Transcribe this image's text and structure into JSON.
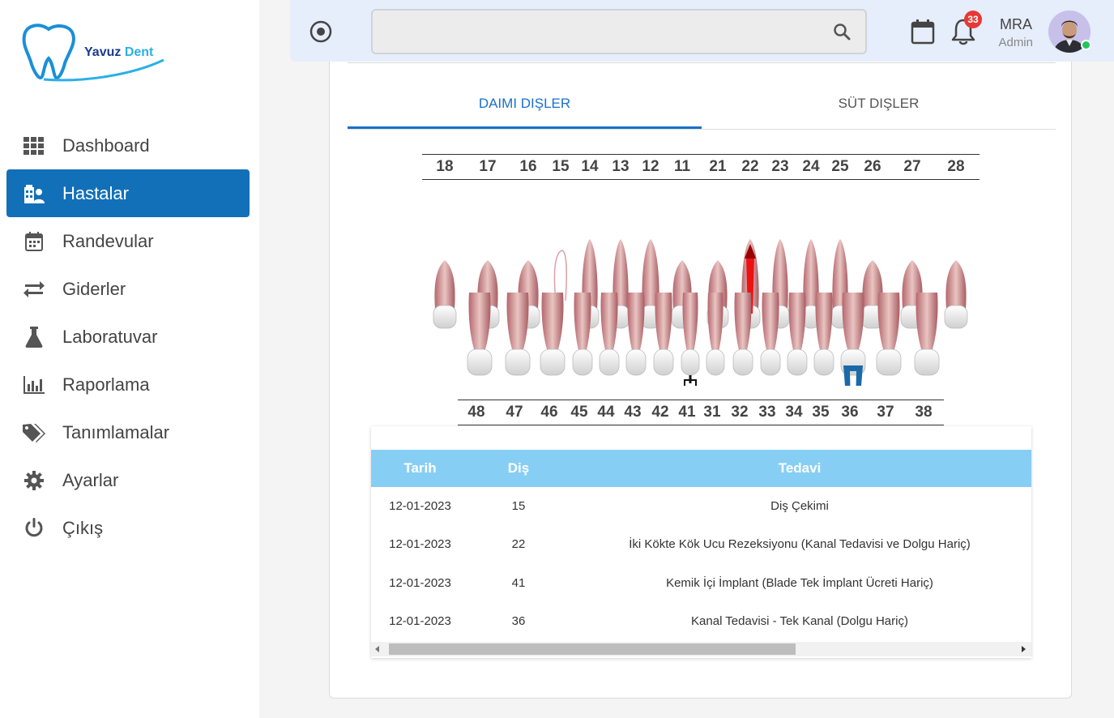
{
  "brand": {
    "name_part1": "Yavuz",
    "name_part2": "Dent"
  },
  "sidebar": {
    "items": [
      {
        "label": "Dashboard",
        "icon": "grid-icon",
        "active": false
      },
      {
        "label": "Hastalar",
        "icon": "patients-building-icon",
        "active": true
      },
      {
        "label": "Randevular",
        "icon": "calendar-icon",
        "active": false
      },
      {
        "label": "Giderler",
        "icon": "swap-arrows-icon",
        "active": false
      },
      {
        "label": "Laboratuvar",
        "icon": "flask-icon",
        "active": false
      },
      {
        "label": "Raporlama",
        "icon": "bar-chart-icon",
        "active": false
      },
      {
        "label": "Tanımlamalar",
        "icon": "tags-icon",
        "active": false
      },
      {
        "label": "Ayarlar",
        "icon": "gear-icon",
        "active": false
      },
      {
        "label": "Çıkış",
        "icon": "power-icon",
        "active": false
      }
    ]
  },
  "topbar": {
    "search_value": "",
    "notification_count": "33",
    "user_name": "MRA",
    "user_role": "Admin"
  },
  "tabs": {
    "permanent": "DAIMI DIŞLER",
    "primary": "SÜT DIŞLER",
    "active": "permanent"
  },
  "chart": {
    "upper_numbers": [
      "18",
      "17",
      "16",
      "15",
      "14",
      "13",
      "12",
      "11",
      "21",
      "22",
      "23",
      "24",
      "25",
      "26",
      "27",
      "28"
    ],
    "lower_numbers": [
      "48",
      "47",
      "46",
      "45",
      "44",
      "43",
      "42",
      "41",
      "31",
      "32",
      "33",
      "34",
      "35",
      "36",
      "37",
      "38"
    ],
    "treated": {
      "extracted": "15",
      "apicoectomy": "22",
      "implant": "41",
      "root_canal": "36"
    }
  },
  "table": {
    "headers": {
      "date": "Tarih",
      "tooth": "Diş",
      "treatment": "Tedavi"
    },
    "rows": [
      {
        "date": "12-01-2023",
        "tooth": "15",
        "treatment": "Diş Çekimi"
      },
      {
        "date": "12-01-2023",
        "tooth": "22",
        "treatment": "İki Kökte Kök Ucu Rezeksiyonu (Kanal Tedavisi ve Dolgu Hariç)"
      },
      {
        "date": "12-01-2023",
        "tooth": "41",
        "treatment": "Kemik İçi İmplant (Blade Tek İmplant Ücreti Hariç)"
      },
      {
        "date": "12-01-2023",
        "tooth": "36",
        "treatment": "Kanal Tedavisi - Tek Kanal (Dolgu Hariç)"
      }
    ]
  },
  "colors": {
    "accent": "#1270b8",
    "table_header": "#87cef5",
    "topbar": "#e6edfb",
    "badge": "#e53935"
  }
}
